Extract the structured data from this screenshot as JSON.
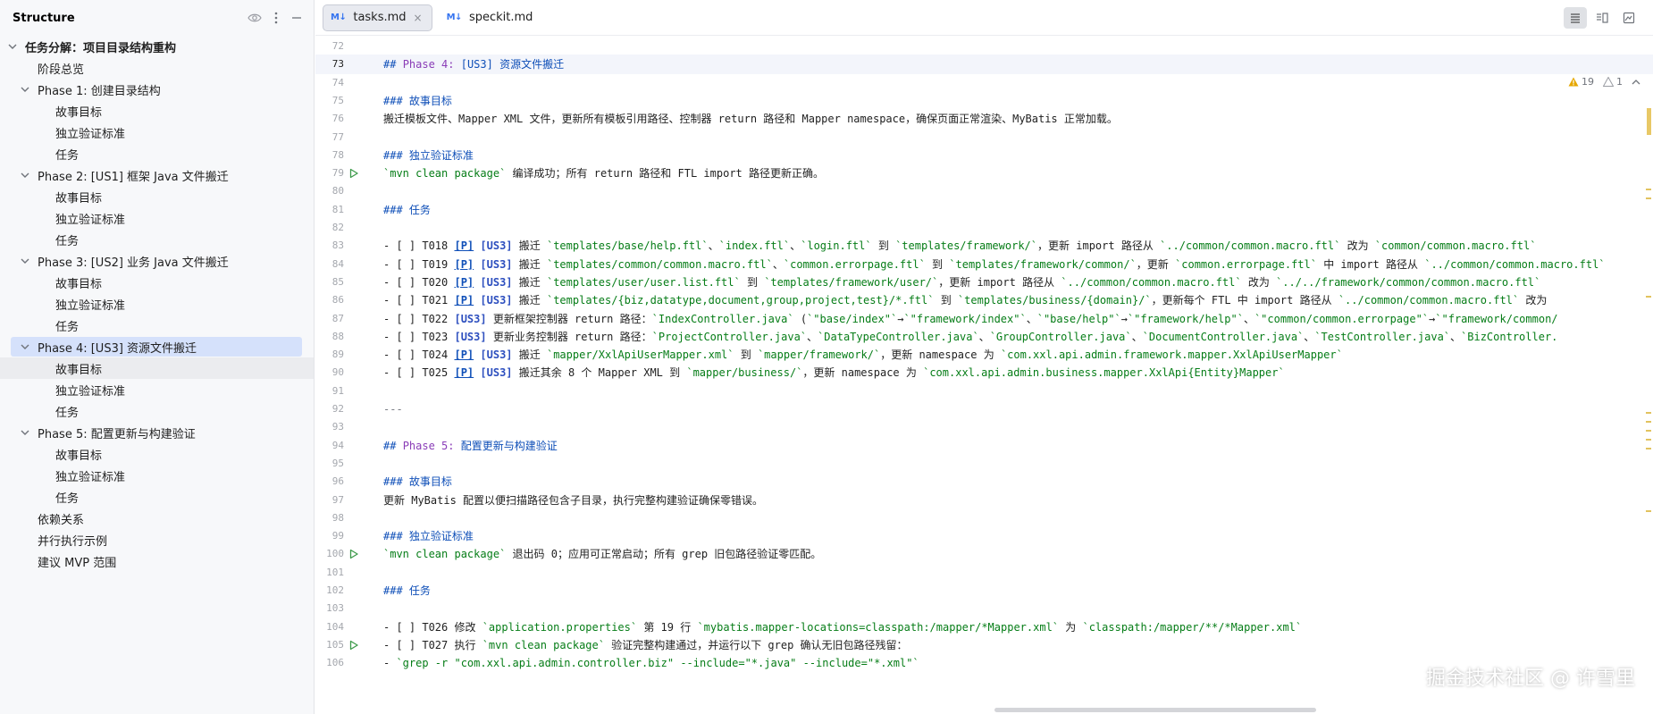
{
  "structure": {
    "title": "Structure",
    "items": [
      {
        "level": "l0",
        "label": "任务分解：项目目录结构重构",
        "chevron": true
      },
      {
        "level": "l1",
        "label": "阶段总览"
      },
      {
        "level": "l1c",
        "label": "Phase 1: 创建目录结构",
        "chevron": true
      },
      {
        "level": "l2",
        "label": "故事目标"
      },
      {
        "level": "l2",
        "label": "独立验证标准"
      },
      {
        "level": "l2",
        "label": "任务"
      },
      {
        "level": "l1c",
        "label": "Phase 2: [US1] 框架 Java 文件搬迁",
        "chevron": true
      },
      {
        "level": "l2",
        "label": "故事目标"
      },
      {
        "level": "l2",
        "label": "独立验证标准"
      },
      {
        "level": "l2",
        "label": "任务"
      },
      {
        "level": "l1c",
        "label": "Phase 3: [US2] 业务 Java 文件搬迁",
        "chevron": true
      },
      {
        "level": "l2",
        "label": "故事目标"
      },
      {
        "level": "l2",
        "label": "独立验证标准"
      },
      {
        "level": "l2",
        "label": "任务"
      },
      {
        "level": "l1c",
        "label": "Phase 4: [US3] 资源文件搬迁",
        "chevron": true,
        "state": "selected"
      },
      {
        "level": "l2",
        "label": "故事目标",
        "state": "hover"
      },
      {
        "level": "l2",
        "label": "独立验证标准"
      },
      {
        "level": "l2",
        "label": "任务"
      },
      {
        "level": "l1c",
        "label": "Phase 5: 配置更新与构建验证",
        "chevron": true
      },
      {
        "level": "l2",
        "label": "故事目标"
      },
      {
        "level": "l2",
        "label": "独立验证标准"
      },
      {
        "level": "l2",
        "label": "任务"
      },
      {
        "level": "l1",
        "label": "依赖关系"
      },
      {
        "level": "l1",
        "label": "并行执行示例"
      },
      {
        "level": "l1",
        "label": "建议 MVP 范围"
      }
    ]
  },
  "tabs": [
    {
      "icon": "M↓",
      "label": "tasks.md",
      "active": true,
      "close": "×"
    },
    {
      "icon": "M↓",
      "label": "speckit.md",
      "active": false
    }
  ],
  "inspections": {
    "warnings": "19",
    "weak_warnings": "1"
  },
  "editor": {
    "lines": [
      {
        "n": "72",
        "parts": []
      },
      {
        "n": "73",
        "caret": true,
        "parts": [
          [
            "c-h",
            "## "
          ],
          [
            "c-ht",
            "Phase 4: "
          ],
          [
            "c-h",
            "[US3] 资源文件搬迁"
          ]
        ]
      },
      {
        "n": "74",
        "parts": []
      },
      {
        "n": "75",
        "parts": [
          [
            "c-h",
            "### 故事目标"
          ]
        ]
      },
      {
        "n": "76",
        "parts": [
          [
            "",
            "搬迁模板文件、Mapper XML 文件，更新所有模板引用路径、控制器 return 路径和 Mapper namespace，确保页面正常渲染、MyBatis 正常加载。"
          ]
        ]
      },
      {
        "n": "77",
        "parts": []
      },
      {
        "n": "78",
        "parts": [
          [
            "c-h",
            "### 独立验证标准"
          ]
        ]
      },
      {
        "n": "79",
        "run": true,
        "parts": [
          [
            "c-code",
            "`mvn clean package`"
          ],
          [
            "",
            " 编译成功；所有 return 路径和 FTL import 路径更新正确。"
          ]
        ]
      },
      {
        "n": "80",
        "parts": []
      },
      {
        "n": "81",
        "parts": [
          [
            "c-h",
            "### 任务"
          ]
        ]
      },
      {
        "n": "82",
        "parts": []
      },
      {
        "n": "83",
        "parts": [
          [
            "",
            "- [ ] T018 "
          ],
          [
            "c-p",
            "[P]"
          ],
          [
            "",
            " "
          ],
          [
            "c-us",
            "[US3]"
          ],
          [
            "",
            " 搬迁 "
          ],
          [
            "c-code",
            "`templates/base/help.ftl`"
          ],
          [
            "",
            "、"
          ],
          [
            "c-code",
            "`index.ftl`"
          ],
          [
            "",
            "、"
          ],
          [
            "c-code",
            "`login.ftl`"
          ],
          [
            "",
            " 到 "
          ],
          [
            "c-code",
            "`templates/framework/`"
          ],
          [
            "",
            "，更新 import 路径从 "
          ],
          [
            "c-code",
            "`../common/common.macro.ftl`"
          ],
          [
            "",
            " 改为 "
          ],
          [
            "c-code",
            "`common/common.macro.ftl`"
          ]
        ]
      },
      {
        "n": "84",
        "parts": [
          [
            "",
            "- [ ] T019 "
          ],
          [
            "c-p",
            "[P]"
          ],
          [
            "",
            " "
          ],
          [
            "c-us",
            "[US3]"
          ],
          [
            "",
            " 搬迁 "
          ],
          [
            "c-code",
            "`templates/common/common.macro.ftl`"
          ],
          [
            "",
            "、"
          ],
          [
            "c-code",
            "`common.errorpage.ftl`"
          ],
          [
            "",
            " 到 "
          ],
          [
            "c-code",
            "`templates/framework/common/`"
          ],
          [
            "",
            "，更新 "
          ],
          [
            "c-code",
            "`common.errorpage.ftl`"
          ],
          [
            "",
            " 中 import 路径从 "
          ],
          [
            "c-code",
            "`../common/common.macro.ftl`"
          ]
        ]
      },
      {
        "n": "85",
        "parts": [
          [
            "",
            "- [ ] T020 "
          ],
          [
            "c-p",
            "[P]"
          ],
          [
            "",
            " "
          ],
          [
            "c-us",
            "[US3]"
          ],
          [
            "",
            " 搬迁 "
          ],
          [
            "c-code",
            "`templates/user/user.list.ftl`"
          ],
          [
            "",
            " 到 "
          ],
          [
            "c-code",
            "`templates/framework/user/`"
          ],
          [
            "",
            "，更新 import 路径从 "
          ],
          [
            "c-code",
            "`../common/common.macro.ftl`"
          ],
          [
            "",
            " 改为 "
          ],
          [
            "c-code",
            "`../../framework/common/common.macro.ftl`"
          ]
        ]
      },
      {
        "n": "86",
        "parts": [
          [
            "",
            "- [ ] T021 "
          ],
          [
            "c-p",
            "[P]"
          ],
          [
            "",
            " "
          ],
          [
            "c-us",
            "[US3]"
          ],
          [
            "",
            " 搬迁 "
          ],
          [
            "c-code",
            "`templates/{biz,datatype,document,group,project,test}/*.ftl`"
          ],
          [
            "",
            " 到 "
          ],
          [
            "c-code",
            "`templates/business/{domain}/`"
          ],
          [
            "",
            "，更新每个 FTL 中 import 路径从 "
          ],
          [
            "c-code",
            "`../common/common.macro.ftl`"
          ],
          [
            "",
            " 改为"
          ]
        ]
      },
      {
        "n": "87",
        "parts": [
          [
            "",
            "- [ ] T022 "
          ],
          [
            "c-us",
            "[US3]"
          ],
          [
            "",
            " 更新框架控制器 return 路径："
          ],
          [
            "c-code",
            "`IndexController.java`"
          ],
          [
            "",
            " ("
          ],
          [
            "c-code",
            "`\"base/index\"`"
          ],
          [
            "",
            "→"
          ],
          [
            "c-code",
            "`\"framework/index\"`"
          ],
          [
            "",
            "、"
          ],
          [
            "c-code",
            "`\"base/help\"`"
          ],
          [
            "",
            "→"
          ],
          [
            "c-code",
            "`\"framework/help\"`"
          ],
          [
            "",
            "、"
          ],
          [
            "c-code",
            "`\"common/common.errorpage\"`"
          ],
          [
            "",
            "→"
          ],
          [
            "c-code",
            "`\"framework/common/"
          ]
        ]
      },
      {
        "n": "88",
        "parts": [
          [
            "",
            "- [ ] T023 "
          ],
          [
            "c-us",
            "[US3]"
          ],
          [
            "",
            " 更新业务控制器 return 路径："
          ],
          [
            "c-code",
            "`ProjectController.java`"
          ],
          [
            "",
            "、"
          ],
          [
            "c-code",
            "`DataTypeController.java`"
          ],
          [
            "",
            "、"
          ],
          [
            "c-code",
            "`GroupController.java`"
          ],
          [
            "",
            "、"
          ],
          [
            "c-code",
            "`DocumentController.java`"
          ],
          [
            "",
            "、"
          ],
          [
            "c-code",
            "`TestController.java`"
          ],
          [
            "",
            "、"
          ],
          [
            "c-code",
            "`BizController."
          ]
        ]
      },
      {
        "n": "89",
        "parts": [
          [
            "",
            "- [ ] T024 "
          ],
          [
            "c-p",
            "[P]"
          ],
          [
            "",
            " "
          ],
          [
            "c-us",
            "[US3]"
          ],
          [
            "",
            " 搬迁 "
          ],
          [
            "c-code",
            "`mapper/XxlApiUserMapper.xml`"
          ],
          [
            "",
            " 到 "
          ],
          [
            "c-code",
            "`mapper/framework/`"
          ],
          [
            "",
            "，更新 namespace 为 "
          ],
          [
            "c-code",
            "`com.xxl.api.admin.framework.mapper.XxlApiUserMapper`"
          ]
        ]
      },
      {
        "n": "90",
        "parts": [
          [
            "",
            "- [ ] T025 "
          ],
          [
            "c-p",
            "[P]"
          ],
          [
            "",
            " "
          ],
          [
            "c-us",
            "[US3]"
          ],
          [
            "",
            " 搬迁其余 8 个 Mapper XML 到 "
          ],
          [
            "c-code",
            "`mapper/business/`"
          ],
          [
            "",
            "，更新 namespace 为 "
          ],
          [
            "c-code",
            "`com.xxl.api.admin.business.mapper.XxlApi{Entity}Mapper`"
          ]
        ]
      },
      {
        "n": "91",
        "parts": []
      },
      {
        "n": "92",
        "parts": [
          [
            "c-hr",
            "---"
          ]
        ]
      },
      {
        "n": "93",
        "parts": []
      },
      {
        "n": "94",
        "parts": [
          [
            "c-h",
            "## "
          ],
          [
            "c-ht",
            "Phase 5: "
          ],
          [
            "c-h",
            "配置更新与构建验证"
          ]
        ]
      },
      {
        "n": "95",
        "parts": []
      },
      {
        "n": "96",
        "parts": [
          [
            "c-h",
            "### 故事目标"
          ]
        ]
      },
      {
        "n": "97",
        "parts": [
          [
            "",
            "更新 MyBatis 配置以便扫描路径包含子目录，执行完整构建验证确保零错误。"
          ]
        ]
      },
      {
        "n": "98",
        "parts": []
      },
      {
        "n": "99",
        "parts": [
          [
            "c-h",
            "### 独立验证标准"
          ]
        ]
      },
      {
        "n": "100",
        "run": true,
        "parts": [
          [
            "c-code",
            "`mvn clean package`"
          ],
          [
            "",
            " 退出码 0；应用可正常启动；所有 grep 旧包路径验证零匹配。"
          ]
        ]
      },
      {
        "n": "101",
        "parts": []
      },
      {
        "n": "102",
        "parts": [
          [
            "c-h",
            "### 任务"
          ]
        ]
      },
      {
        "n": "103",
        "parts": []
      },
      {
        "n": "104",
        "parts": [
          [
            "",
            "- [ ] T026 修改 "
          ],
          [
            "c-code",
            "`application.properties`"
          ],
          [
            "",
            " 第 19 行 "
          ],
          [
            "c-code",
            "`mybatis.mapper-locations=classpath:/mapper/*Mapper.xml`"
          ],
          [
            "",
            " 为 "
          ],
          [
            "c-code",
            "`classpath:/mapper/**/*Mapper.xml`"
          ]
        ]
      },
      {
        "n": "105",
        "run": true,
        "parts": [
          [
            "",
            "- [ ] T027 执行 "
          ],
          [
            "c-code",
            "`mvn clean package`"
          ],
          [
            "",
            " 验证完整构建通过，并运行以下 grep 确认无旧包路径残留："
          ]
        ]
      },
      {
        "n": "106",
        "parts": [
          [
            "",
            "  - "
          ],
          [
            "c-code",
            "`grep -r \"com.xxl.api.admin.controller.biz\" --include=\"*.java\" --include=\"*.xml\"`"
          ]
        ]
      }
    ]
  },
  "watermark": "掘金技术社区 @ 许雪里"
}
